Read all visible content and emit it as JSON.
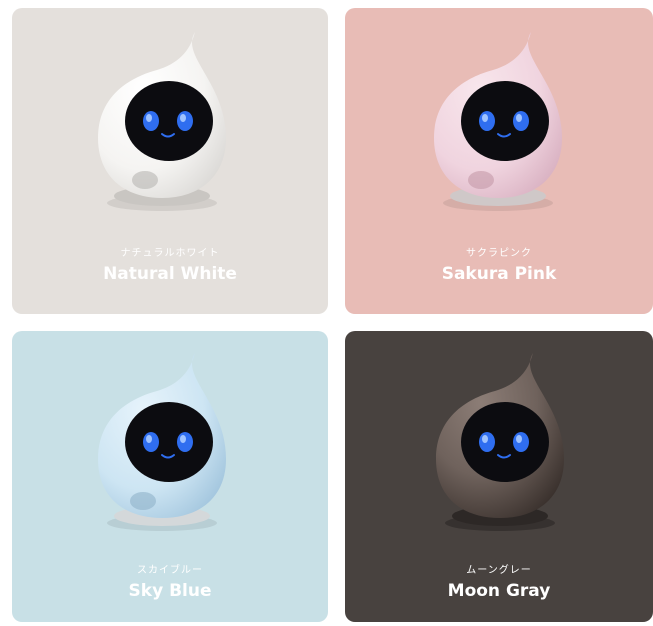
{
  "products": [
    {
      "jp_name": "ナチュラルホワイト",
      "en_name": "Natural White",
      "bg_color": "#e4e0dc",
      "body_color": "#f5f4f2",
      "body_shade": "#d9d7d4",
      "base_color": "#c9c6c2"
    },
    {
      "jp_name": "サクラピンク",
      "en_name": "Sakura Pink",
      "bg_color": "#e8bcb6",
      "body_color": "#f0d4df",
      "body_shade": "#d7aebf",
      "base_color": "#cfc8c8"
    },
    {
      "jp_name": "スカイブルー",
      "en_name": "Sky Blue",
      "bg_color": "#c8e0e6",
      "body_color": "#cde5f3",
      "body_shade": "#9fc3dc",
      "base_color": "#d4d8da"
    },
    {
      "jp_name": "ムーングレー",
      "en_name": "Moon Gray",
      "bg_color": "#48423f",
      "body_color": "#6f625c",
      "body_shade": "#3a312d",
      "base_color": "#2d2826"
    }
  ],
  "eye_color": "#2f6ef0",
  "screen_color": "#0c0c10"
}
